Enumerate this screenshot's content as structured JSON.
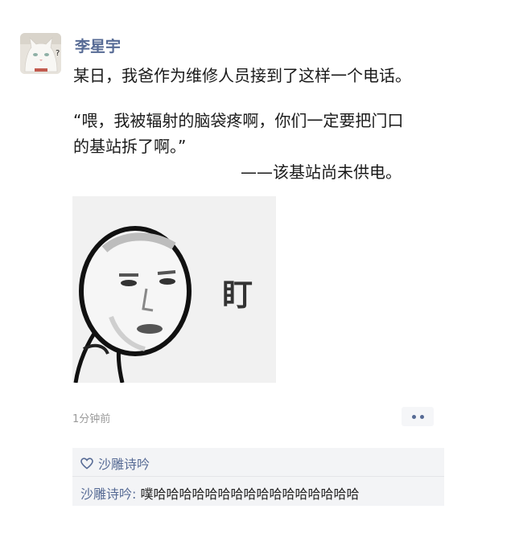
{
  "post": {
    "author": "李星宇",
    "lines": [
      "某日，我爸作为维修人员接到了这样一个电话。",
      "“喂，我被辐射的脑袋疼啊，你们一定要把门口",
      "的基站拆了啊。”",
      "——该基站尚未供电。"
    ],
    "meme_caption": "盯",
    "time": "1分钟前"
  },
  "interactions": {
    "like_icon": "heart-outline-icon",
    "likes": "沙雕诗吟",
    "comment_author": "沙雕诗吟:",
    "comment_text": " 噗哈哈哈哈哈哈哈哈哈哈哈哈哈哈哈哈"
  },
  "colors": {
    "name_blue": "#576b95",
    "interaction_bg": "#f3f4f6",
    "text": "#1a1a1a"
  }
}
